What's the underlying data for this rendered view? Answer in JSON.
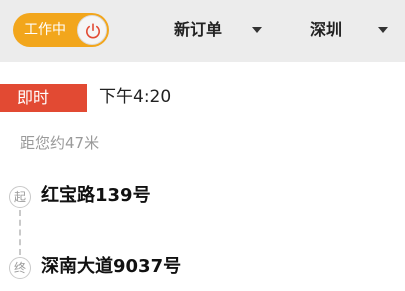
{
  "header": {
    "status_toggle": {
      "label": "工作中",
      "on": true
    },
    "order_filter": {
      "selected": "新订单"
    },
    "city_filter": {
      "selected": "深圳"
    }
  },
  "order": {
    "type_badge": "即时",
    "time": "下午4:20",
    "distance": "距您约47米",
    "start": {
      "marker": "起",
      "address": "红宝路139号"
    },
    "end": {
      "marker": "终",
      "address": "深南大道9037号"
    }
  },
  "colors": {
    "toggle_bg": "#f2a61c",
    "badge_bg": "#e24a33",
    "power_icon": "#e24a33",
    "header_bg": "#ececec"
  },
  "icons": {
    "toggle_knob": "power-icon",
    "dropdown": "chevron-down-icon"
  }
}
